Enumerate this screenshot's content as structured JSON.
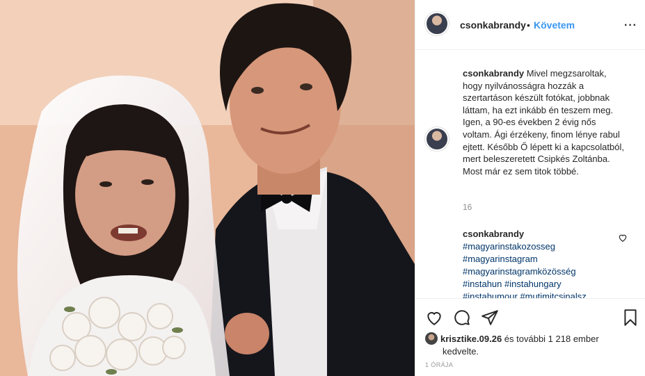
{
  "post": {
    "username": "csonkabrandy",
    "separator": "•",
    "follow_label": "Követem",
    "more_label": "···"
  },
  "caption": {
    "username": "csonkabrandy",
    "text": "Mivel megzsaroltak, hogy nyilvánosságra hozzák a szertartáson készült fotókat, jobbnak láttam, ha ezt inkább én teszem meg. Igen, a 90-es években 2 évig nős voltam. Ági érzékeny, finom lénye rabul ejtett. Később Ő lépett ki a kapcsolatból, mert beleszeretett Csipkés Zoltánba. Most már ez sem titok többé.",
    "time": "16"
  },
  "comment": {
    "username": "csonkabrandy",
    "hashtags": [
      "#magyarinstakozosseg",
      "#magyarinstagram",
      "#magyarinstagramközösség",
      "#instahun #instahungary",
      "#instahumour #mutimitcsinalsz"
    ]
  },
  "likes": {
    "user": "krisztike.09.26",
    "rest": " és további 1 218 ember",
    "suffix": "kedvelte."
  },
  "timestamp": "1 ÓRÁJA",
  "icons": {
    "like": "heart-icon",
    "comment": "comment-icon",
    "share": "share-icon",
    "save": "bookmark-icon",
    "comment_like": "heart-small-icon"
  },
  "colors": {
    "link": "#3897f0",
    "hashtag": "#003569",
    "muted": "#8e8e8e"
  }
}
